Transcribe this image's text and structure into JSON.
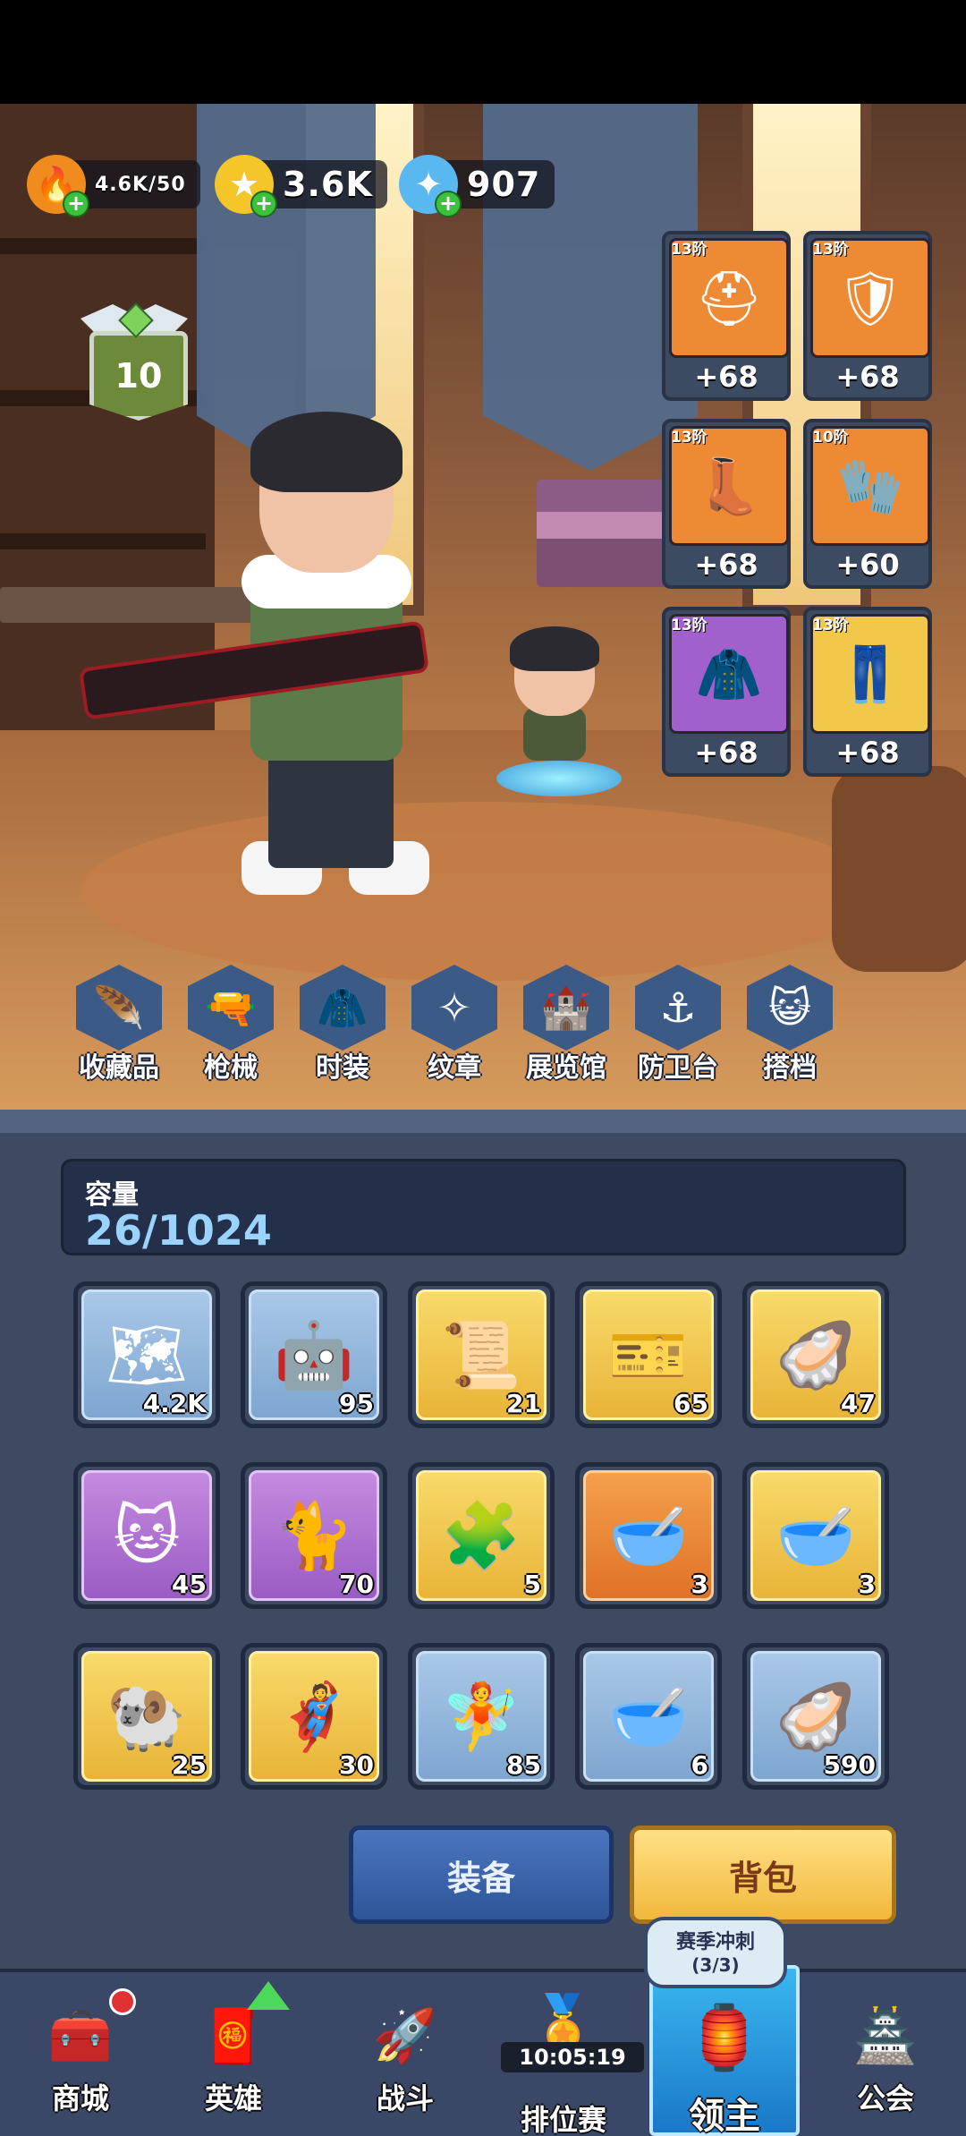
{
  "currencies": [
    {
      "name": "stamina",
      "icon": "flame-icon",
      "value": "4.6K/50"
    },
    {
      "name": "gold",
      "icon": "gold-coin-icon",
      "value": "3.6K"
    },
    {
      "name": "crystal",
      "icon": "crystal-star-icon",
      "value": "907"
    }
  ],
  "player": {
    "level": "10"
  },
  "equipment": [
    {
      "slot": "helmet",
      "icon": "helmet-icon",
      "tier": "13阶",
      "bonus": "+68",
      "rarity": "orange"
    },
    {
      "slot": "armor",
      "icon": "chest-armor-icon",
      "tier": "13阶",
      "bonus": "+68",
      "rarity": "orange"
    },
    {
      "slot": "boots",
      "icon": "boots-icon",
      "tier": "13阶",
      "bonus": "+68",
      "rarity": "orange"
    },
    {
      "slot": "gloves",
      "icon": "gloves-icon",
      "tier": "10阶",
      "bonus": "+60",
      "rarity": "orange"
    },
    {
      "slot": "cloak",
      "icon": "cloak-icon",
      "tier": "13阶",
      "bonus": "+68",
      "rarity": "purple"
    },
    {
      "slot": "pants",
      "icon": "pants-icon",
      "tier": "13阶",
      "bonus": "+68",
      "rarity": "gold"
    }
  ],
  "features": [
    {
      "label": "收藏品",
      "icon": "feather-icon"
    },
    {
      "label": "枪械",
      "icon": "gun-icon"
    },
    {
      "label": "时装",
      "icon": "jacket-icon"
    },
    {
      "label": "纹章",
      "icon": "emblem-icon"
    },
    {
      "label": "展览馆",
      "icon": "castle-icon"
    },
    {
      "label": "防卫台",
      "icon": "turret-icon"
    },
    {
      "label": "搭档",
      "icon": "partner-icon"
    }
  ],
  "inventory": {
    "capacity_label": "容量",
    "capacity_value": "26/1024",
    "items": [
      {
        "icon": "map-scroll-icon",
        "count": "4.2K",
        "rarity": "blue"
      },
      {
        "icon": "robot-fragment-icon",
        "count": "95",
        "rarity": "blue"
      },
      {
        "icon": "star-scroll-icon",
        "count": "21",
        "rarity": "gold"
      },
      {
        "icon": "ticket-icon",
        "count": "65",
        "rarity": "gold"
      },
      {
        "icon": "pearl-shell-icon",
        "count": "47",
        "rarity": "gold"
      },
      {
        "icon": "cat-fragment-icon",
        "count": "45",
        "rarity": "purple"
      },
      {
        "icon": "blue-cat-fragment-icon",
        "count": "70",
        "rarity": "purple"
      },
      {
        "icon": "puzzle-card-icon",
        "count": "5",
        "rarity": "gold"
      },
      {
        "icon": "gold-bowl-icon",
        "count": "3",
        "rarity": "orange"
      },
      {
        "icon": "gold-bowl-icon",
        "count": "3",
        "rarity": "gold"
      },
      {
        "icon": "ram-fragment-icon",
        "count": "25",
        "rarity": "gold"
      },
      {
        "icon": "knight-fragment-icon",
        "count": "30",
        "rarity": "gold"
      },
      {
        "icon": "fairy-fragment-icon",
        "count": "85",
        "rarity": "blue"
      },
      {
        "icon": "water-bowl-icon",
        "count": "6",
        "rarity": "blue"
      },
      {
        "icon": "pearl-shell-icon",
        "count": "590",
        "rarity": "blue"
      }
    ]
  },
  "buttons": {
    "equip": "装备",
    "bag": "背包"
  },
  "nav": {
    "items": [
      {
        "label": "商城",
        "icon": "shop-chest-icon"
      },
      {
        "label": "英雄",
        "icon": "hero-card-icon"
      },
      {
        "label": "战斗",
        "icon": "battle-icon"
      },
      {
        "label": "排位赛",
        "icon": "ranked-badge-icon"
      },
      {
        "label": "领主",
        "icon": "lord-banner-icon"
      },
      {
        "label": "公会",
        "icon": "guild-hall-icon"
      }
    ],
    "season_title": "赛季冲刺",
    "season_progress": "(3/3)",
    "timer": "10:05:19",
    "active": "领主"
  },
  "colors": {
    "panel": "#3d4a62",
    "rarity_blue": "#8fb5dd",
    "rarity_purple": "#b070d2",
    "rarity_gold": "#f1c64c",
    "rarity_orange": "#ec8a38",
    "nav_active": "#2a94dc"
  }
}
